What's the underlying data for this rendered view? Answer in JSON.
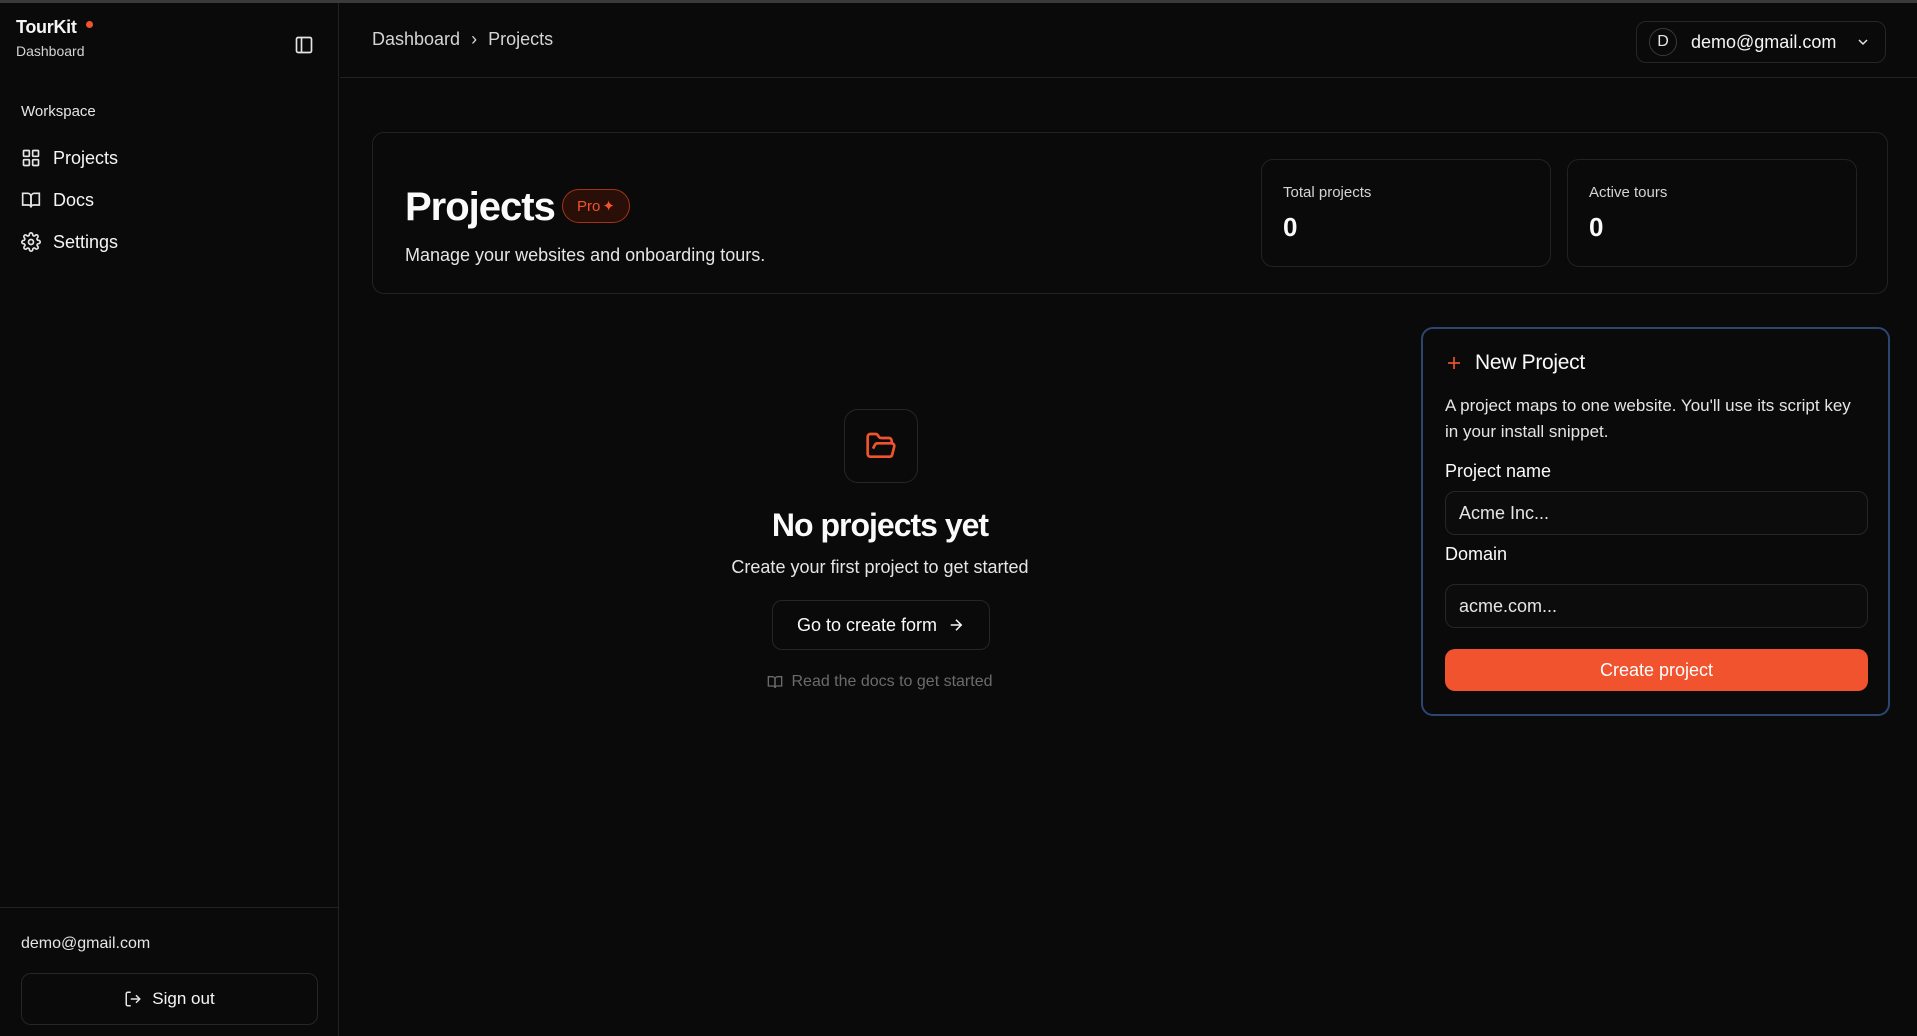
{
  "brand": {
    "name": "TourKit",
    "subtitle": "Dashboard"
  },
  "sidebar": {
    "section_label": "Workspace",
    "items": [
      {
        "label": "Projects",
        "icon": "grid-icon"
      },
      {
        "label": "Docs",
        "icon": "book-icon"
      },
      {
        "label": "Settings",
        "icon": "gear-icon"
      }
    ],
    "footer": {
      "email": "demo@gmail.com",
      "signout_label": "Sign out"
    }
  },
  "header": {
    "breadcrumb": [
      "Dashboard",
      "Projects"
    ],
    "breadcrumb_separator": "›",
    "user": {
      "initial": "D",
      "email": "demo@gmail.com"
    }
  },
  "hero": {
    "title": "Projects",
    "badge": "Pro",
    "badge_glyph": "✦",
    "description": "Manage your websites and onboarding tours.",
    "stats": [
      {
        "label": "Total projects",
        "value": "0"
      },
      {
        "label": "Active tours",
        "value": "0"
      }
    ]
  },
  "empty_state": {
    "title": "No projects yet",
    "subtitle": "Create your first project to get started",
    "button_label": "Go to create form",
    "docs_link": "Read the docs to get started"
  },
  "new_project": {
    "title": "New Project",
    "description": "A project maps to one website. You'll use its script key in your install snippet.",
    "name_label": "Project name",
    "name_placeholder": "Acme Inc...",
    "domain_label": "Domain",
    "domain_placeholder": "acme.com...",
    "submit_label": "Create project"
  },
  "colors": {
    "background": "#0a0a0a",
    "accent": "#f0532d",
    "card_border": "#2d4670",
    "border": "#222222"
  }
}
